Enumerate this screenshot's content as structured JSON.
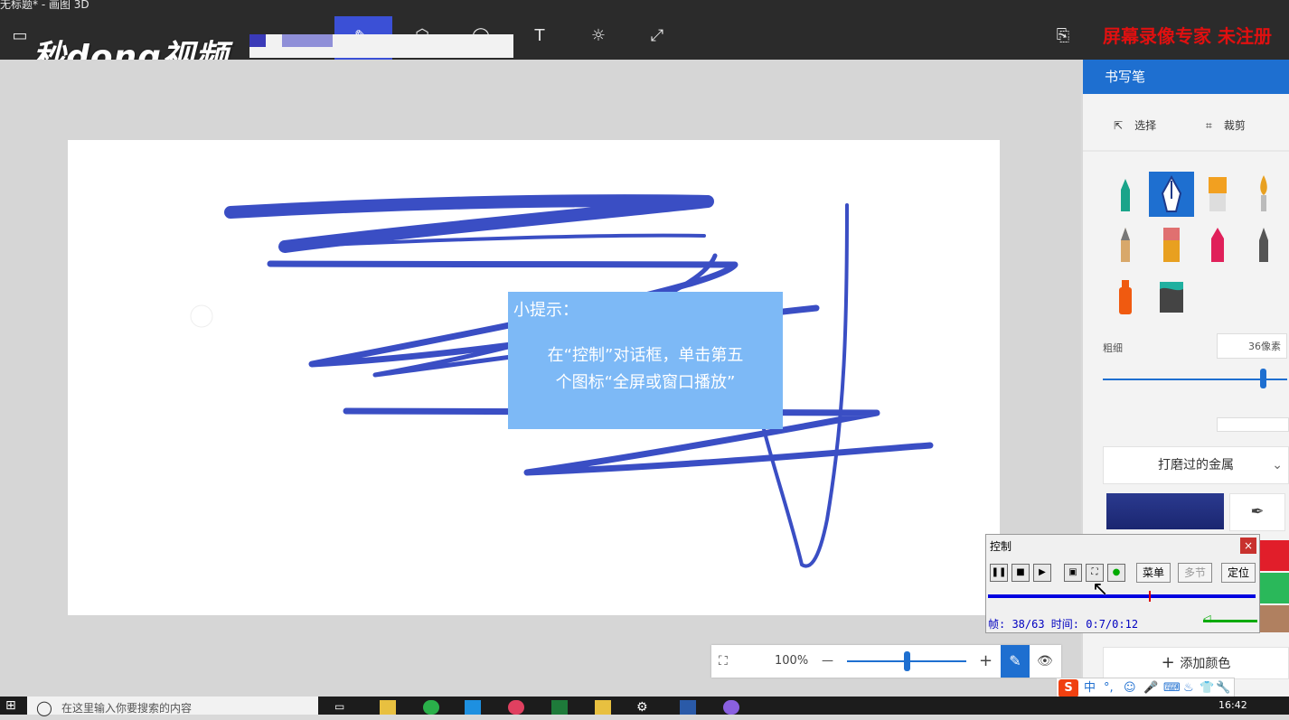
{
  "window": {
    "title": "无标题* - 画图 3D"
  },
  "watermark": {
    "logo_text": "秒dong视频",
    "red_notice": "屏幕录像专家 未注册"
  },
  "toolbar": {
    "icons": [
      "menu-icon",
      "brush-icon",
      "3d-shapes-icon",
      "sticker-icon",
      "text-icon",
      "effects-icon",
      "canvas-icon",
      "paste-icon"
    ],
    "text_tool_glyph": "T"
  },
  "tip": {
    "title": "小提示：",
    "body_line1": "在“控制”对话框，单击第五",
    "body_line2": "个图标“全屏或窗口播放”"
  },
  "panel": {
    "header": "书写笔",
    "select_label": "选择",
    "crop_label": "裁剪",
    "thickness_label": "粗细",
    "thickness_value": "36像素",
    "thickness_fraction": 0.87,
    "material": "打磨过的金属",
    "add_color": "添加颜色",
    "accent": "#1e6fd0"
  },
  "zoom": {
    "value": "100%",
    "minus": "—",
    "plus": "+",
    "level_fraction": 0.5
  },
  "control_dialog": {
    "title": "控制",
    "close": "×",
    "menu_button": "菜单",
    "multi_button": "多节",
    "locate_button": "定位",
    "status": "帧: 38/63 时间: 0:7/0:12",
    "progress_fraction": 0.6
  },
  "ime": {
    "logo": "S",
    "mode": "中"
  },
  "taskbar": {
    "search_placeholder": "在这里输入你要搜索的内容",
    "clock": "16:42"
  }
}
